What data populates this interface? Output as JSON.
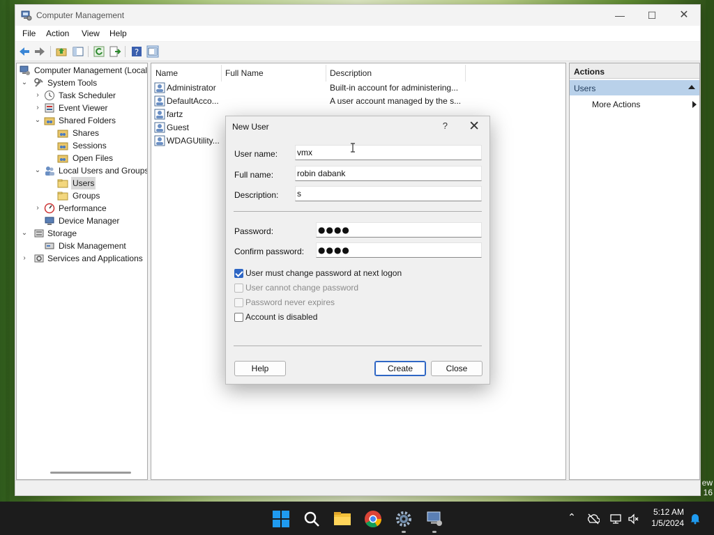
{
  "window": {
    "title": "Computer Management",
    "controls": {
      "minimize": "—",
      "maximize": "☐",
      "close": "✕"
    }
  },
  "menu": [
    "File",
    "Action",
    "View",
    "Help"
  ],
  "tree": {
    "root": "Computer Management (Local",
    "items": [
      {
        "label": "System Tools",
        "expander": "⌄"
      },
      {
        "label": "Task Scheduler",
        "expander": "›"
      },
      {
        "label": "Event Viewer",
        "expander": "›"
      },
      {
        "label": "Shared Folders",
        "expander": "⌄"
      },
      {
        "label": "Shares"
      },
      {
        "label": "Sessions"
      },
      {
        "label": "Open Files"
      },
      {
        "label": "Local Users and Groups",
        "expander": "⌄"
      },
      {
        "label": "Users"
      },
      {
        "label": "Groups"
      },
      {
        "label": "Performance",
        "expander": "›"
      },
      {
        "label": "Device Manager"
      },
      {
        "label": "Storage",
        "expander": "⌄"
      },
      {
        "label": "Disk Management"
      },
      {
        "label": "Services and Applications",
        "expander": "›"
      }
    ]
  },
  "list": {
    "columns": [
      "Name",
      "Full Name",
      "Description"
    ],
    "rows": [
      {
        "name": "Administrator",
        "fullname": "",
        "description": "Built-in account for administering..."
      },
      {
        "name": "DefaultAcco...",
        "fullname": "",
        "description": "A user account managed by the s..."
      },
      {
        "name": "fartz",
        "fullname": "",
        "description": ""
      },
      {
        "name": "Guest",
        "fullname": "",
        "description": ""
      },
      {
        "name": "WDAGUtility...",
        "fullname": "",
        "description": ""
      }
    ]
  },
  "actions": {
    "header": "Actions",
    "group": "Users",
    "items": [
      "More Actions"
    ]
  },
  "dialog": {
    "title": "New User",
    "help_glyph": "?",
    "close_glyph": "✕",
    "fields": {
      "username": {
        "label": "User name:",
        "value": "vmx"
      },
      "fullname": {
        "label": "Full name:",
        "value": "robin dabank"
      },
      "description": {
        "label": "Description:",
        "value": "s"
      },
      "password": {
        "label": "Password:",
        "value": "●●●●"
      },
      "confirm": {
        "label": "Confirm password:",
        "value": "●●●●"
      }
    },
    "checkboxes": [
      {
        "label": "User must change password at next logon",
        "checked": true,
        "enabled": true
      },
      {
        "label": "User cannot change password",
        "checked": false,
        "enabled": false
      },
      {
        "label": "Password never expires",
        "checked": false,
        "enabled": false
      },
      {
        "label": "Account is disabled",
        "checked": false,
        "enabled": true
      }
    ],
    "buttons": {
      "help": "Help",
      "create": "Create",
      "close": "Close"
    }
  },
  "taskbar": {
    "time": "5:12 AM",
    "date": "1/5/2024",
    "tray_up": "⌃",
    "edge_text_1": "ew",
    "edge_text_2": "16"
  },
  "colors": {
    "accent": "#2e66c4",
    "selection": "#b9d1ea",
    "taskbar": "#1c1c1c"
  }
}
